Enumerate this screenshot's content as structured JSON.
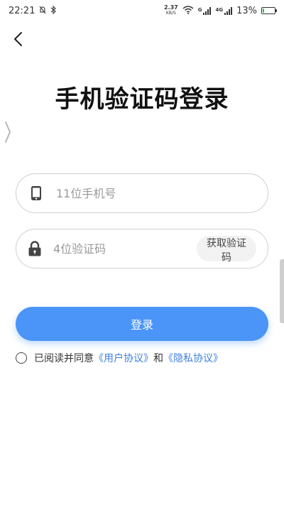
{
  "status_bar": {
    "time": "22:21",
    "net_speed_value": "2.37",
    "net_speed_unit": "KB/S",
    "signal_tag_1": "G",
    "signal_tag_2": "4G",
    "battery_percent": "13%",
    "battery_level": 0.13
  },
  "page": {
    "title": "手机验证码登录"
  },
  "phone_input": {
    "placeholder": "11位手机号",
    "value": ""
  },
  "code_input": {
    "placeholder": "4位验证码",
    "value": "",
    "get_code_label": "获取验证码"
  },
  "login_button": {
    "label": "登录"
  },
  "agreement": {
    "prefix": "已阅读并同意",
    "user_agreement": "《用户协议》",
    "conjunction": "和",
    "privacy_policy": "《隐私协议》"
  },
  "colors": {
    "primary": "#4a95f7",
    "link": "#3d7fe0"
  },
  "icons": {
    "back": "chevron-left-icon",
    "phone": "phone-icon",
    "lock": "lock-icon",
    "side_handle": "chevron-right-icon"
  }
}
